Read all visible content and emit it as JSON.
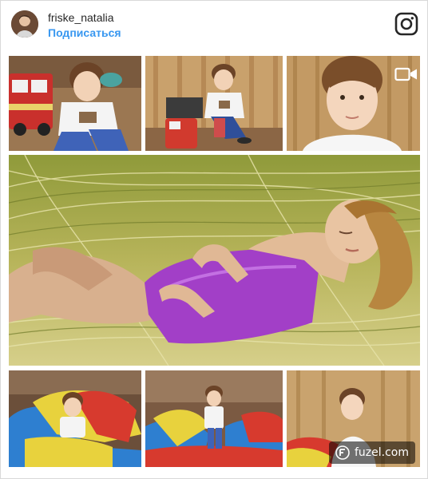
{
  "header": {
    "username": "friske_natalia",
    "follow_label": "Подписаться",
    "avatar_icon": "profile-avatar",
    "app_icon": "instagram-icon"
  },
  "collage": {
    "video_indicator_icon": "video-camera-icon",
    "watermark": {
      "icon": "fuzel-logo-icon",
      "text": "fuzel.com"
    }
  },
  "colors": {
    "link_blue": "#3897f0",
    "text_dark": "#262626",
    "border": "#d9d9d9"
  }
}
